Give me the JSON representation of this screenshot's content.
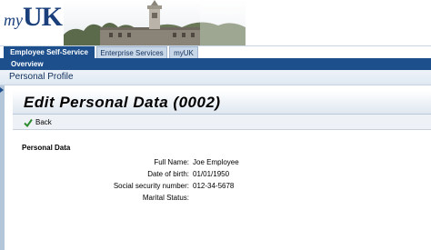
{
  "brand": {
    "logo_prefix": "my",
    "logo_main": "UK"
  },
  "tabs": [
    {
      "label": "Employee Self-Service",
      "active": true
    },
    {
      "label": "Enterprise Services",
      "active": false
    },
    {
      "label": "myUK",
      "active": false
    }
  ],
  "subnav": {
    "items": [
      "Overview"
    ]
  },
  "profile": {
    "title": "Personal Profile"
  },
  "page": {
    "title": "Edit Personal Data (0002)"
  },
  "toolbar": {
    "back_label": "Back"
  },
  "section": {
    "title": "Personal Data"
  },
  "fields": [
    {
      "label": "Full Name:",
      "value": "Joe Employee"
    },
    {
      "label": "Date of birth:",
      "value": "01/01/1950"
    },
    {
      "label": "Social security number:",
      "value": "012-34-5678"
    },
    {
      "label": "Marital Status:",
      "value": ""
    }
  ],
  "colors": {
    "brand_blue": "#1d4f8c",
    "logo_blue": "#1a3f7a",
    "check_green": "#2e8b2e"
  }
}
